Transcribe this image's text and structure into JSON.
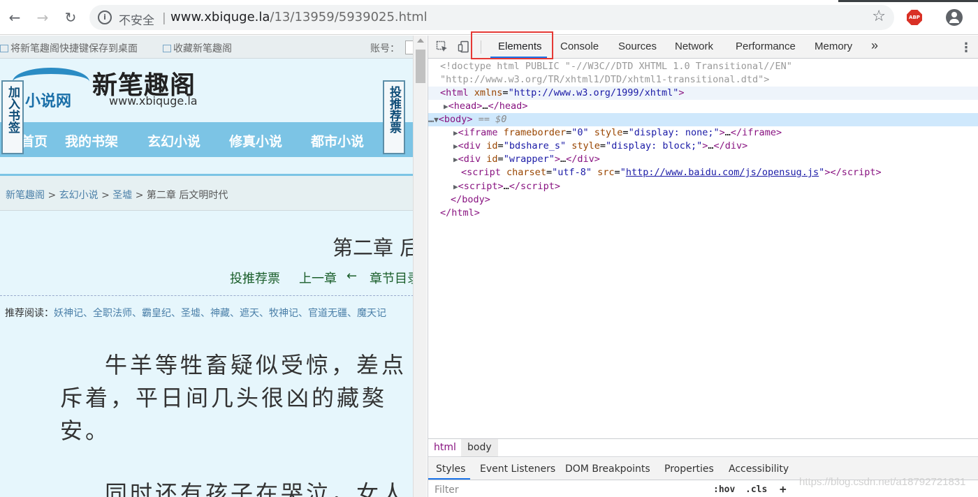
{
  "browser": {
    "insecure_label": "不安全",
    "separator": "|",
    "url_host": "www.xbiquge.la",
    "url_path": "/13/13959/5939025.html",
    "abp_label": "ABP"
  },
  "site": {
    "topbar": {
      "save_shortcut": "将新笔趣阁快捷键保存到桌面",
      "bookmark_site": "收藏新笔趣阁",
      "account_label": "账号："
    },
    "logo": {
      "subtitle": "小说网",
      "name": "新笔趣阁",
      "url": "www.xbiquge.la"
    },
    "left_tag": "加入书签",
    "right_tag": "投推荐票",
    "menu": [
      "首页",
      "我的书架",
      "玄幻小说",
      "修真小说",
      "都市小说"
    ],
    "breadcrumb": {
      "home": "新笔趣阁",
      "category": "玄幻小说",
      "book": "圣墟",
      "sep": ">",
      "current": "第二章 后文明时代"
    },
    "chapter_title": "第二章 后文明时代",
    "chapter_nav": {
      "recommend": "投推荐票",
      "prev": "上一章",
      "arrow": "←",
      "toc": "章节目录"
    },
    "recommend_reading": {
      "label": "推荐阅读：",
      "books": "妖神记、全职法师、霸皇纪、圣墟、神藏、遮天、牧神记、官道无疆、魔天记"
    },
    "paragraphs": [
      "牛羊等牲畜疑似受惊，差点",
      "斥着，平日间几头很凶的藏獒",
      "安。",
      "同时还有孩子在哭泣，女人"
    ]
  },
  "devtools": {
    "tabs": [
      "Elements",
      "Console",
      "Sources",
      "Network",
      "Performance",
      "Memory"
    ],
    "more_tabs": "»",
    "dom": {
      "doctype_1": "<!doctype html PUBLIC \"-//W3C//DTD XHTML 1.0 Transitional//EN\"",
      "doctype_2": "\"http://www.w3.org/TR/xhtml1/DTD/xhtml1-transitional.dtd\">",
      "html_xmlns": "http://www.w3.org/1999/xhtml",
      "iframe_frameborder": "0",
      "iframe_style": "display: none;",
      "div1_id": "bdshare_s",
      "div1_style": "display: block;",
      "div2_id": "wrapper",
      "script_charset": "utf-8",
      "script_src": "http://www.baidu.com/js/opensug.js",
      "selected_marker": "== $0"
    },
    "breadcrumb": [
      "html",
      "body"
    ],
    "sub_tabs": [
      "Styles",
      "Event Listeners",
      "DOM Breakpoints",
      "Properties",
      "Accessibility"
    ],
    "filter_placeholder": "Filter",
    "hov": ":hov",
    "cls": ".cls",
    "plus": "+"
  },
  "watermark": "https://blog.csdn.net/a18792721831"
}
